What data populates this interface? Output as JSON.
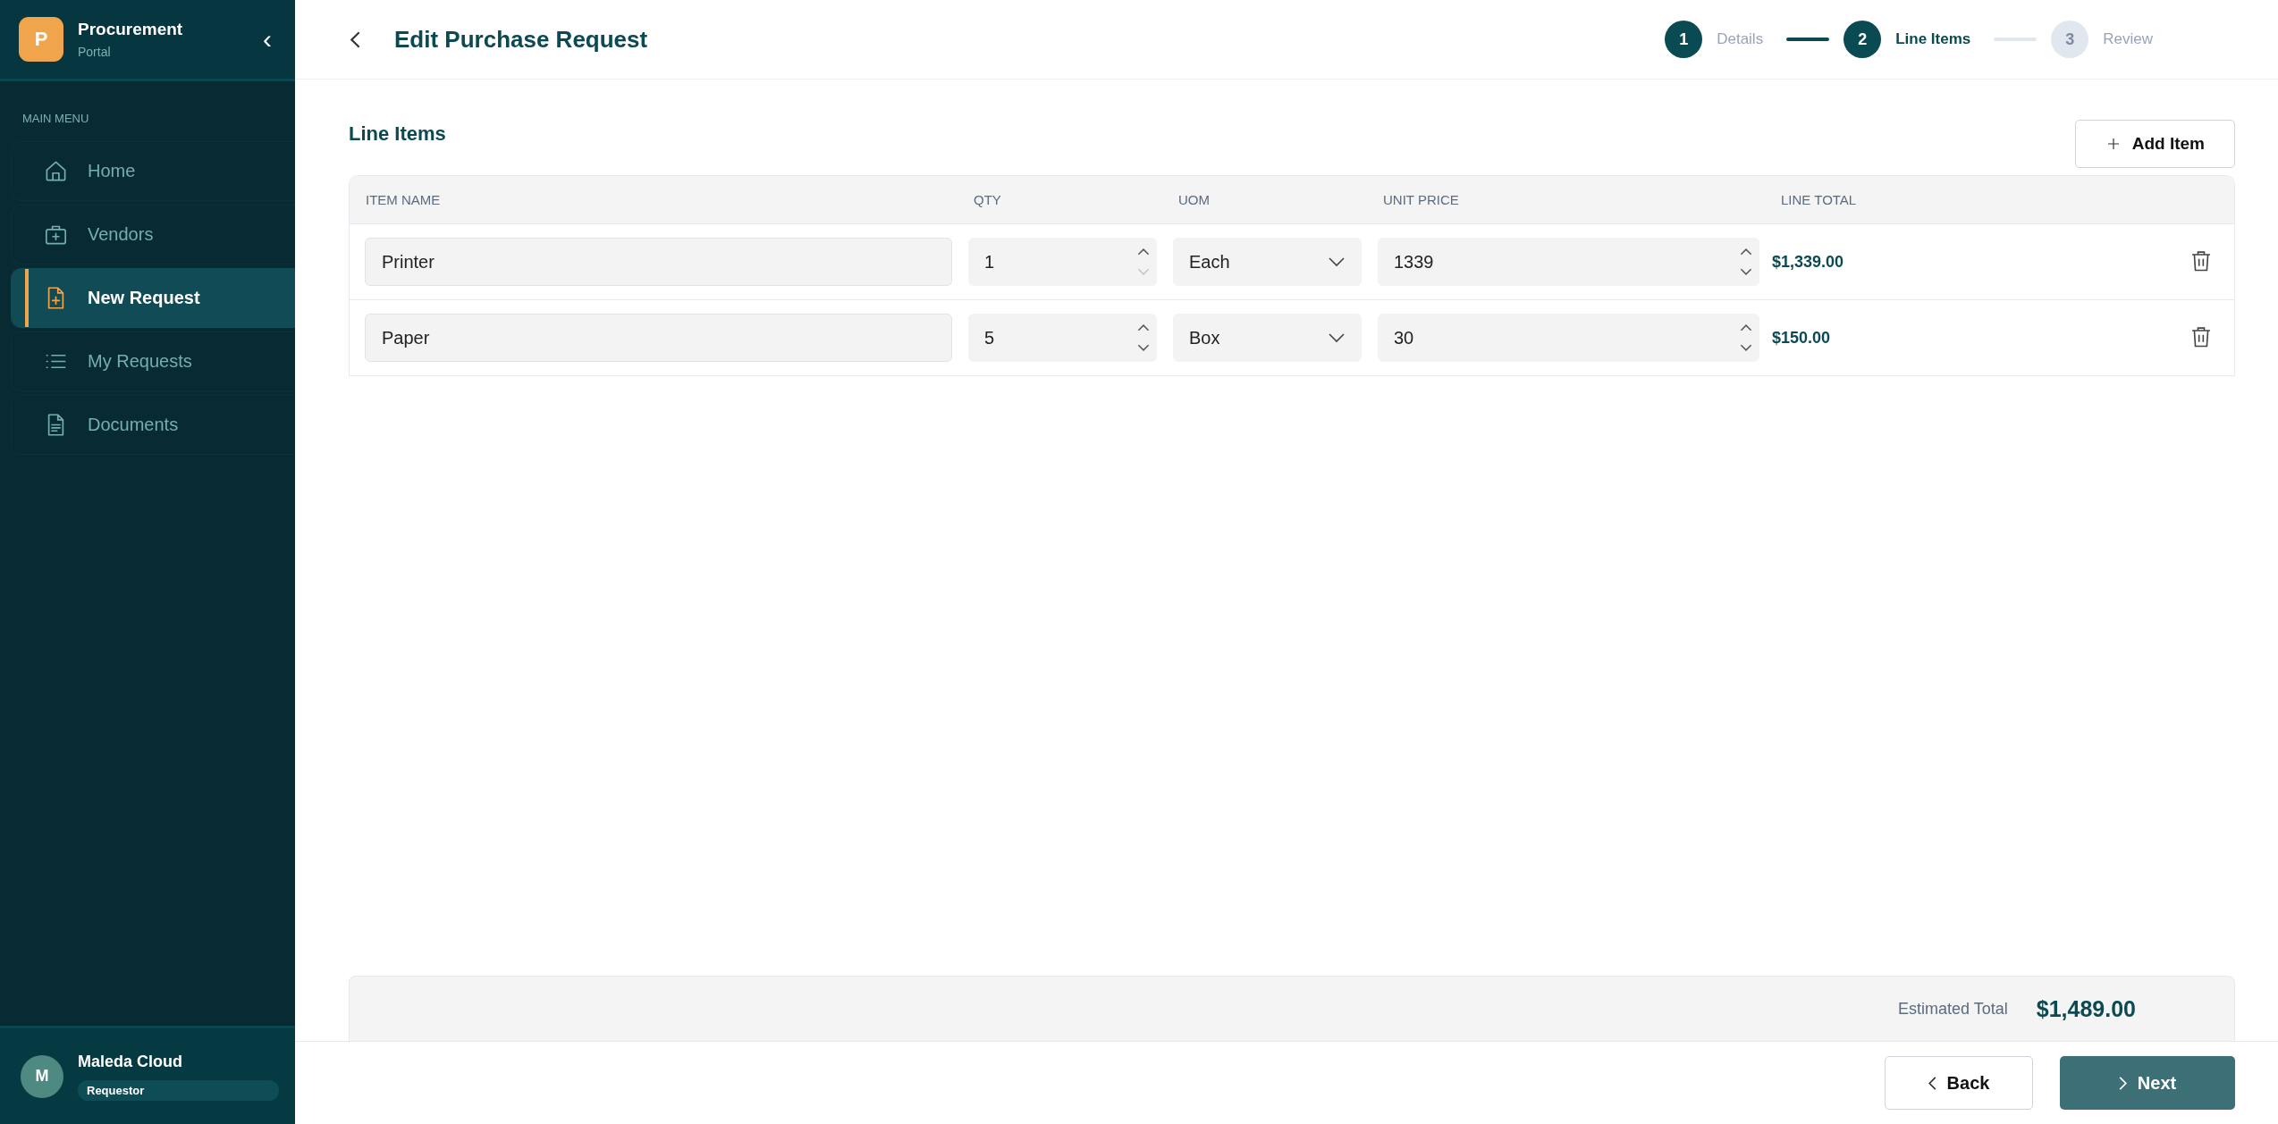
{
  "sidebar": {
    "logo_letter": "P",
    "app_name": "Procurement",
    "app_subtitle": "Portal",
    "collapse_glyph": "‹",
    "section_label": "MAIN MENU",
    "items": [
      {
        "label": "Home",
        "kind": "home",
        "selected": false
      },
      {
        "label": "Vendors",
        "kind": "briefcase",
        "selected": false
      },
      {
        "label": "New Request",
        "kind": "fileplus",
        "selected": true
      },
      {
        "label": "My Requests",
        "kind": "list",
        "selected": false
      },
      {
        "label": "Documents",
        "kind": "document",
        "selected": false
      }
    ],
    "user": {
      "initial": "M",
      "name": "Maleda Cloud",
      "role": "Requestor"
    }
  },
  "header": {
    "title": "Edit Purchase Request",
    "steps": [
      {
        "number": "1",
        "label": "Details",
        "kind": "done"
      },
      {
        "number": "2",
        "label": "Line Items",
        "kind": "current"
      },
      {
        "number": "3",
        "label": "Review",
        "kind": "upcoming"
      }
    ]
  },
  "section": {
    "title": "Line Items",
    "add_button": "Add Item"
  },
  "table": {
    "columns": [
      "ITEM NAME",
      "QTY",
      "UOM",
      "UNIT PRICE",
      "LINE TOTAL"
    ],
    "rows": [
      {
        "item_name": "Printer",
        "qty": "1",
        "qty_decrement_disabled": true,
        "uom": "Each",
        "unit_price": "1339",
        "line_total": "$1,339.00"
      },
      {
        "item_name": "Paper",
        "qty": "5",
        "qty_decrement_disabled": false,
        "uom": "Box",
        "unit_price": "30",
        "line_total": "$150.00"
      }
    ]
  },
  "summary": {
    "label": "Estimated Total",
    "value": "$1,489.00"
  },
  "footer": {
    "back_button": "Back",
    "next_button": "Next"
  }
}
